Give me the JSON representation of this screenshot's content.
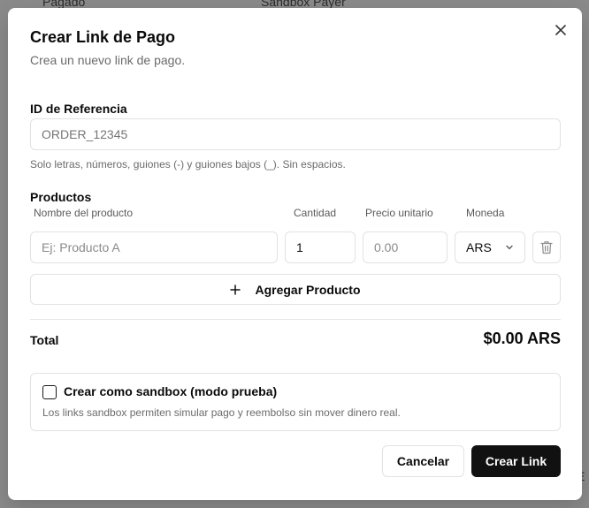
{
  "background": {
    "left_text": "Pagado",
    "center_text": "Sandbox Payer",
    "right_text": "E"
  },
  "dialog": {
    "title": "Crear Link de Pago",
    "subtitle": "Crea un nuevo link de pago.",
    "close_icon": "close-icon"
  },
  "reference": {
    "label": "ID de Referencia",
    "placeholder": "ORDER_12345",
    "value": "",
    "hint": "Solo letras, números, guiones (-) y guiones bajos (_). Sin espacios."
  },
  "products": {
    "label": "Productos",
    "columns": {
      "name": "Nombre del producto",
      "quantity": "Cantidad",
      "unit_price": "Precio unitario",
      "currency": "Moneda"
    },
    "row": {
      "name_placeholder": "Ej: Producto A",
      "quantity_value": "1",
      "price_placeholder": "0.00",
      "currency_value": "ARS",
      "delete_icon": "trash-icon"
    },
    "add_button": "Agregar Producto",
    "add_icon": "plus-icon"
  },
  "total": {
    "label": "Total",
    "value": "$0.00 ARS"
  },
  "sandbox": {
    "label": "Crear como sandbox (modo prueba)",
    "description": "Los links sandbox permiten simular pago y reembolso sin mover dinero real.",
    "checked": false
  },
  "footer": {
    "cancel": "Cancelar",
    "submit": "Crear Link"
  },
  "colors": {
    "primary": "#111111",
    "border": "#e2e2e2",
    "muted_text": "#6b6b6b"
  }
}
